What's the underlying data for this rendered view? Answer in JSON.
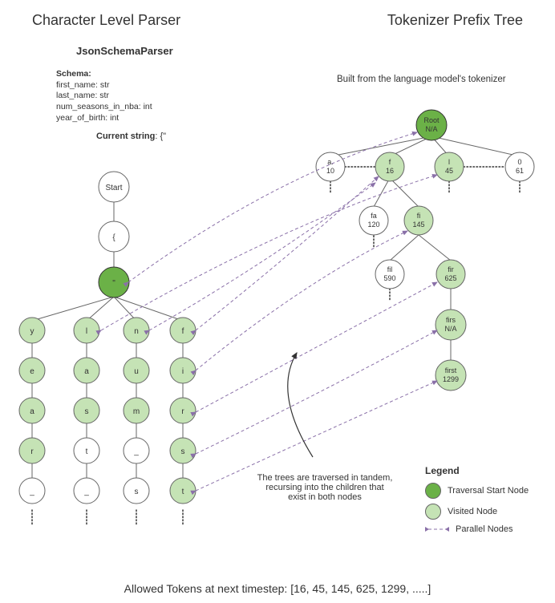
{
  "titles": {
    "left": "Character Level Parser",
    "right": "Tokenizer Prefix Tree",
    "subtitle": "JsonSchemaParser",
    "built_from": "Built from the language model's tokenizer"
  },
  "schema": {
    "title": "Schema:",
    "lines": [
      "first_name: str",
      "last_name: str",
      "num_seasons_in_nba: int",
      "year_of_birth: int"
    ]
  },
  "current_string": {
    "label": "Current string",
    "value": ": {\""
  },
  "parser_tree": {
    "start": "Start",
    "brace": "{",
    "quote": "\"",
    "columns": [
      [
        "y",
        "e",
        "a",
        "r",
        "_"
      ],
      [
        "l",
        "a",
        "s",
        "t",
        "_"
      ],
      [
        "n",
        "u",
        "m",
        "_",
        "s"
      ],
      [
        "f",
        "i",
        "r",
        "s",
        "t"
      ]
    ],
    "visited_col0": [
      true,
      true,
      true,
      true,
      false
    ],
    "visited_col1": [
      true,
      true,
      true,
      false,
      false
    ],
    "visited_col2": [
      true,
      true,
      true,
      false,
      false
    ],
    "visited_col3": [
      true,
      true,
      true,
      true,
      true
    ]
  },
  "tokenizer_tree": {
    "root": {
      "l1": "Root",
      "l2": "N/A"
    },
    "row1": [
      {
        "l1": "a.",
        "l2": "10",
        "visited": false
      },
      {
        "l1": "f",
        "l2": "16",
        "visited": true
      },
      {
        "l1": "l",
        "l2": "45",
        "visited": true
      },
      {
        "l1": "0",
        "l2": "61",
        "visited": false
      }
    ],
    "row2": [
      {
        "l1": "fa",
        "l2": "120",
        "visited": false
      },
      {
        "l1": "fi",
        "l2": "145",
        "visited": true
      }
    ],
    "row3": [
      {
        "l1": "fil",
        "l2": "590",
        "visited": false
      },
      {
        "l1": "fir",
        "l2": "625",
        "visited": true
      }
    ],
    "row4": {
      "l1": "firs",
      "l2": "N/A",
      "visited": true
    },
    "row5": {
      "l1": "first",
      "l2": "1299",
      "visited": true
    }
  },
  "caption": {
    "line1": "The trees are traversed in tandem,",
    "line2": "recursing into the children that",
    "line3": "exist in both nodes"
  },
  "legend": {
    "title": "Legend",
    "start": "Traversal Start Node",
    "visited": "Visited Node",
    "parallel": "Parallel Nodes"
  },
  "footer": "Allowed Tokens at next timestep: [16, 45, 145, 625, 1299, .....]",
  "chart_data": {
    "type": "table",
    "description": "Diagram showing parallel traversal of a character-level JSON schema parser tree and a tokenizer prefix tree",
    "allowed_tokens_next_timestep": [
      16,
      45,
      145,
      625,
      1299
    ],
    "parser_branches_after_quote": [
      "year_",
      "last_",
      "num_s",
      "first"
    ],
    "tokenizer_nodes": [
      {
        "string": "Root",
        "token_id": null
      },
      {
        "string": "a.",
        "token_id": 10
      },
      {
        "string": "f",
        "token_id": 16
      },
      {
        "string": "l",
        "token_id": 45
      },
      {
        "string": "0",
        "token_id": 61
      },
      {
        "string": "fa",
        "token_id": 120
      },
      {
        "string": "fi",
        "token_id": 145
      },
      {
        "string": "fil",
        "token_id": 590
      },
      {
        "string": "fir",
        "token_id": 625
      },
      {
        "string": "firs",
        "token_id": null
      },
      {
        "string": "first",
        "token_id": 1299
      }
    ],
    "schema_fields": {
      "first_name": "str",
      "last_name": "str",
      "num_seasons_in_nba": "int",
      "year_of_birth": "int"
    },
    "current_string": "{\""
  }
}
